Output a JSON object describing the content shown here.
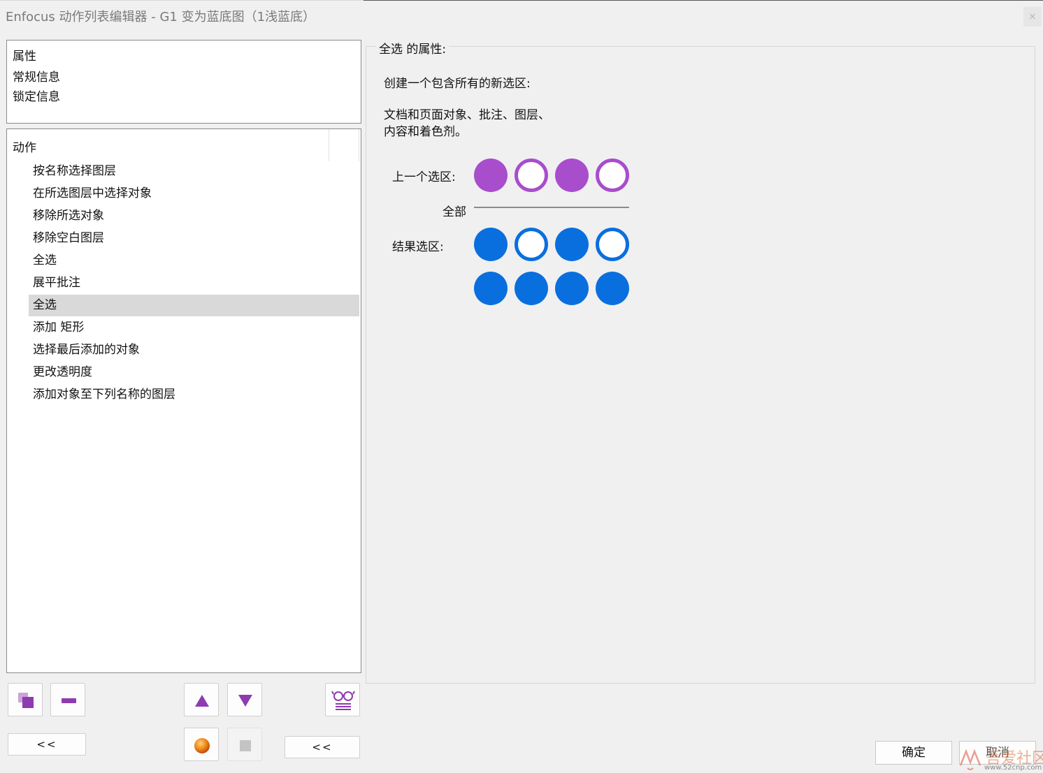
{
  "window": {
    "title": "Enfocus 动作列表编辑器 - G1 变为蓝底图（1浅蓝底）",
    "close_glyph": "×"
  },
  "properties_panel": {
    "items": [
      "属性",
      "常规信息",
      "锁定信息"
    ]
  },
  "actions_panel": {
    "header": "动作",
    "items": [
      "按名称选择图层",
      "在所选图层中选择对象",
      "移除所选对象",
      "移除空白图层",
      "全选",
      "展平批注",
      "全选",
      "添加 矩形",
      "选择最后添加的对象",
      "更改透明度",
      "添加对象至下列名称的图层"
    ],
    "selected_index": 6
  },
  "toolbar": {
    "collapse_left_label": "<<",
    "collapse_mid_label": "<<",
    "icons": [
      "duplicate-icon",
      "remove-icon",
      "move-up-icon",
      "move-down-icon",
      "glasses-list-icon",
      "record-icon",
      "stop-icon"
    ]
  },
  "detail": {
    "group_title": "全选 的属性:",
    "description_1": "创建一个包含所有的新选区:",
    "description_2_line1": "文档和页面对象、批注、图层、",
    "description_2_line2": "内容和着色剂。",
    "previous_selection_label": "上一个选区:",
    "operation_label": "全部",
    "result_selection_label": "结果选区:",
    "colors": {
      "previous": "#a84dcc",
      "result": "#0a6fde"
    },
    "previous_pattern": [
      "filled",
      "hollow",
      "filled",
      "hollow"
    ],
    "result_pattern_row1": [
      "filled",
      "hollow",
      "filled",
      "hollow"
    ],
    "result_pattern_row2": [
      "filled",
      "filled",
      "filled",
      "filled"
    ]
  },
  "footer": {
    "ok_label": "确定",
    "cancel_label": "取消"
  },
  "watermark": {
    "text": "吾爱社区",
    "url": "www.52cnp.com"
  }
}
